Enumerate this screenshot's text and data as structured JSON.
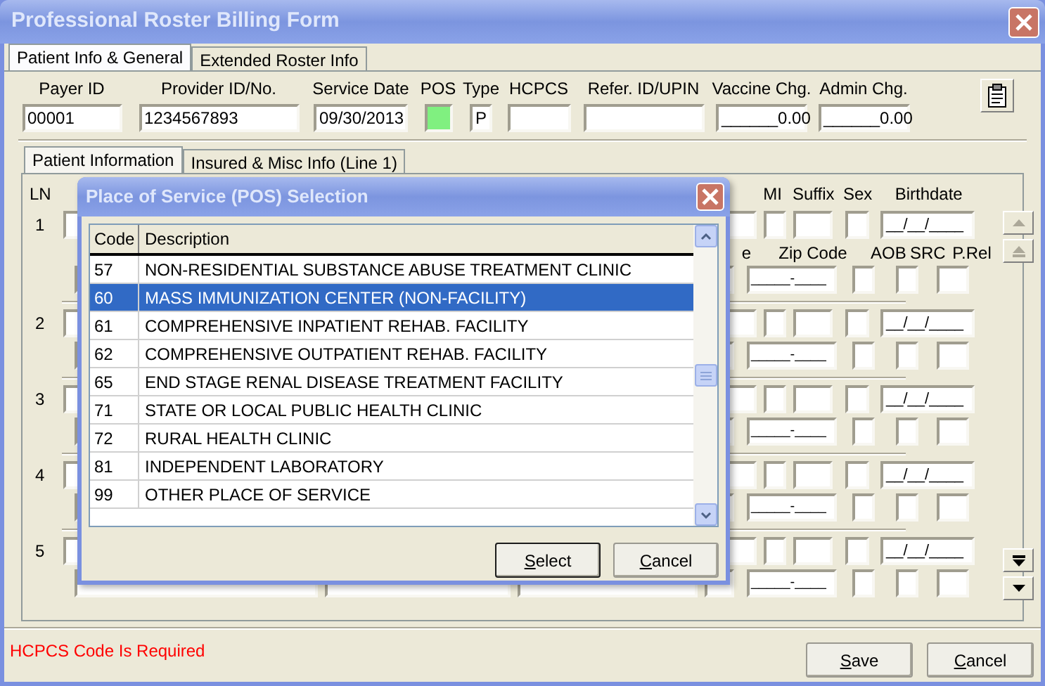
{
  "window": {
    "title": "Professional Roster Billing Form"
  },
  "tabs": [
    {
      "label": "Patient Info & General",
      "selected": true
    },
    {
      "label": "Extended Roster Info",
      "selected": false
    }
  ],
  "header_fields": [
    {
      "label": "Payer ID",
      "value": "00001",
      "highlighted": false
    },
    {
      "label": "Provider ID/No.",
      "value": "1234567893",
      "highlighted": false
    },
    {
      "label": "Service Date",
      "value": "09/30/2013",
      "highlighted": false
    },
    {
      "label": "POS",
      "highlighted": true
    },
    {
      "label": "Type",
      "value": "P",
      "highlighted": false
    },
    {
      "label": "HCPCS",
      "highlighted": false
    },
    {
      "label": "Refer. ID/UPIN",
      "highlighted": false
    },
    {
      "label": "Vaccine Chg.",
      "value": "______0.00",
      "highlighted": false
    },
    {
      "label": "Admin Chg.",
      "value": "______0.00",
      "highlighted": false
    }
  ],
  "inner_tabs": [
    {
      "label": "Patient Information",
      "selected": true
    },
    {
      "label": "Insured & Misc Info (Line 1)",
      "selected": false
    }
  ],
  "ln_label": "LN",
  "row1_labels": [
    "MI",
    "Suffix",
    "Sex",
    "Birthdate"
  ],
  "row2_labels": [
    "e",
    "Zip Code",
    "AOB",
    "SRC",
    "P.Rel"
  ],
  "lines": [
    {
      "number": "1",
      "birthdate": "__/__/____",
      "zip": "_____-____"
    },
    {
      "number": "2",
      "birthdate": "__/__/____",
      "zip": "_____-____"
    },
    {
      "number": "3",
      "birthdate": "__/__/____",
      "zip": "_____-____"
    },
    {
      "number": "4",
      "birthdate": "__/__/____",
      "zip": "_____-____"
    },
    {
      "number": "5",
      "birthdate": "__/__/____",
      "zip": "_____-____"
    }
  ],
  "scroll_buttons": [
    {
      "kind": "up",
      "disabled": true
    },
    {
      "kind": "top",
      "disabled": true
    },
    {
      "kind": "bottom",
      "disabled": false
    },
    {
      "kind": "down",
      "disabled": false
    }
  ],
  "status": "HCPCS Code Is Required",
  "buttons": [
    "Save",
    "Cancel"
  ],
  "dialog": {
    "title": "Place of Service (POS) Selection",
    "columns": [
      "Code",
      "Description"
    ],
    "rows": [
      {
        "code": "57",
        "description": "NON-RESIDENTIAL SUBSTANCE ABUSE TREATMENT CLINIC",
        "selected": false
      },
      {
        "code": "60",
        "description": "MASS IMMUNIZATION CENTER (NON-FACILITY)",
        "selected": true
      },
      {
        "code": "61",
        "description": "COMPREHENSIVE INPATIENT REHAB. FACILITY",
        "selected": false
      },
      {
        "code": "62",
        "description": "COMPREHENSIVE OUTPATIENT REHAB. FACILITY",
        "selected": false
      },
      {
        "code": "65",
        "description": "END STAGE RENAL DISEASE TREATMENT FACILITY",
        "selected": false
      },
      {
        "code": "71",
        "description": "STATE OR LOCAL PUBLIC HEALTH CLINIC",
        "selected": false
      },
      {
        "code": "72",
        "description": "RURAL HEALTH CLINIC",
        "selected": false
      },
      {
        "code": "81",
        "description": "INDEPENDENT LABORATORY",
        "selected": false
      },
      {
        "code": "99",
        "description": "OTHER PLACE OF SERVICE",
        "selected": false
      }
    ],
    "buttons": [
      "Select",
      "Cancel"
    ]
  }
}
